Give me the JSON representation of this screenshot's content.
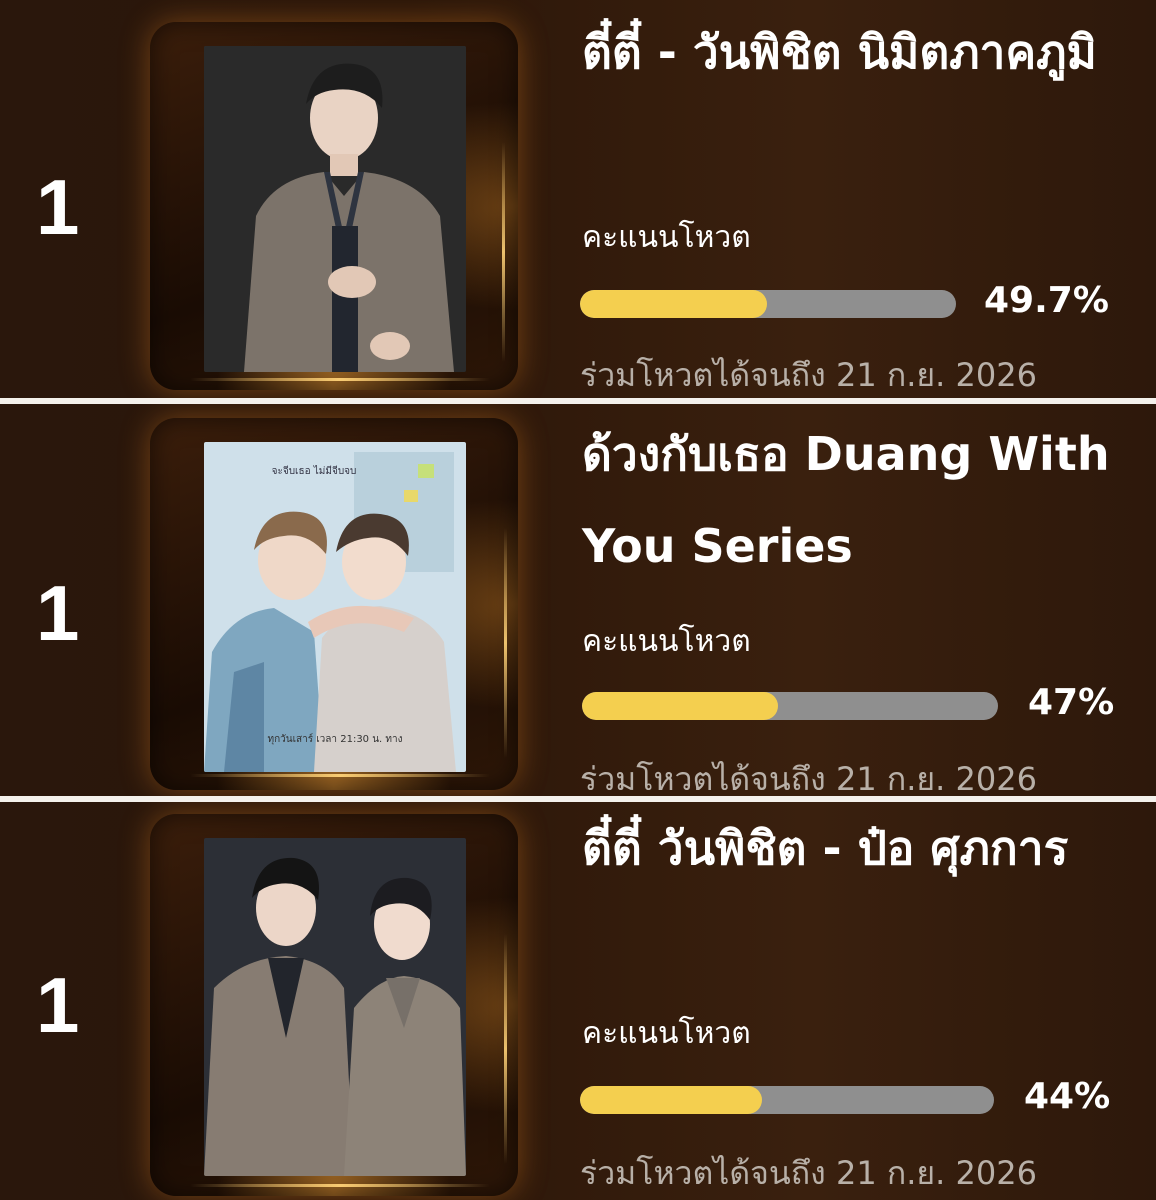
{
  "entries": [
    {
      "rank": "1",
      "title": "ตี๋ตี๋ - วันพิชิต นิมิตภาคภูมิ",
      "vote_label": "คะแนนโหวต",
      "percent_text": "49.7%",
      "percent": 49.7,
      "deadline": "ร่วมโหวตได้จนถึง 21 ก.ย. 2026",
      "photo_icon": "portrait-photo-single"
    },
    {
      "rank": "1",
      "title": "ด้วงกับเธอ Duang With You Series",
      "vote_label": "คะแนนโหวต",
      "percent_text": "47%",
      "percent": 47,
      "deadline": "ร่วมโหวตได้จนถึง 21 ก.ย. 2026",
      "photo_icon": "series-poster",
      "poster_text": {
        "top": "จะจีบเธอ ไม่มีจีบจบ",
        "bottom": "ทุกวันเสาร์ เวลา 21:30 น. ทาง"
      }
    },
    {
      "rank": "1",
      "title": "ตี๋ตี๋ วันพิชิต - ป๋อ ศุภการ",
      "vote_label": "คะแนนโหวต",
      "percent_text": "44%",
      "percent": 44,
      "deadline": "ร่วมโหวตได้จนถึง 21 ก.ย. 2026",
      "photo_icon": "portrait-photo-duo"
    }
  ],
  "colors": {
    "background": "#2b1609",
    "bar_track": "#8f8f8f",
    "bar_fill": "#f4cf4f",
    "text_primary": "#ffffff",
    "text_muted": "#b8b0a8",
    "separator": "#f4f1ec"
  }
}
